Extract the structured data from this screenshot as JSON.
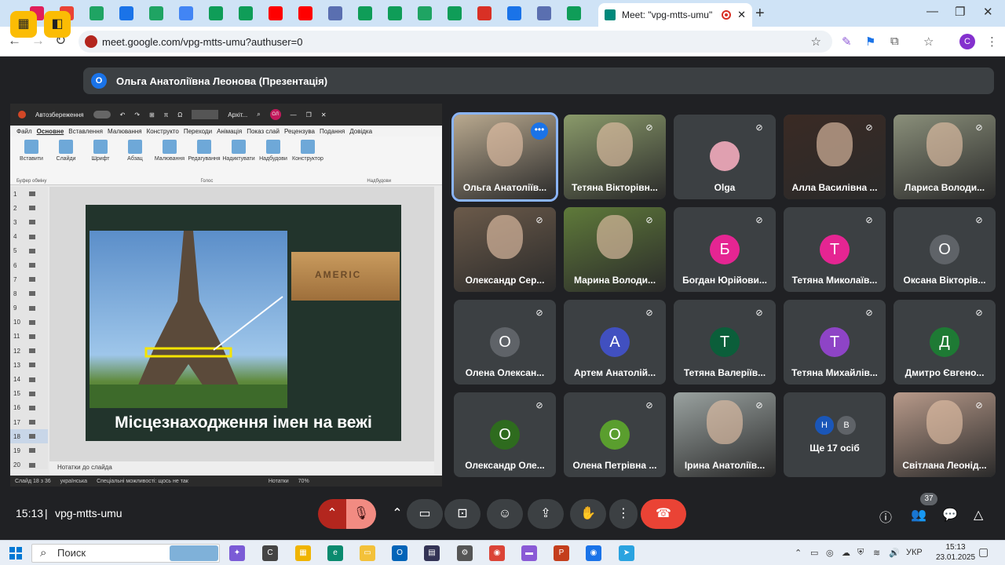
{
  "browser": {
    "active_tab_title": "Meet: \"vpg-mtts-umu\"",
    "url": "meet.google.com/vpg-mtts-umu?authuser=0",
    "profile_initial": "C",
    "tab_icons": [
      "slack-icon",
      "gmail-icon",
      "drive-icon",
      "contacts-icon",
      "drive-icon",
      "docs-icon",
      "sheets-icon",
      "sheets-icon",
      "youtube-icon",
      "youtube-icon",
      "site-icon",
      "sheets-icon",
      "sheets-icon",
      "drive-icon",
      "sheets-icon",
      "heart-icon",
      "notion-icon",
      "site-icon",
      "sheets-icon"
    ]
  },
  "presenter": {
    "initial": "О",
    "label": "Ольга Анатоліївна Леонова (Презентація)"
  },
  "presentation": {
    "autosave": "Автозбереження",
    "search_hint": "Архіт...",
    "user_initials": "ОЛ",
    "menu": [
      "Файл",
      "Основне",
      "Вставлення",
      "Малювання",
      "Конструкто",
      "Переходи",
      "Анімація",
      "Показ слай",
      "Рецензува",
      "Подання",
      "Довідка"
    ],
    "ribbon": [
      "Вставити",
      "Слайди",
      "Шрифт",
      "Абзац",
      "Малювання",
      "Редагування",
      "Надиктувати",
      "Надбудови",
      "Конструктор"
    ],
    "ribbon_groups": [
      "Буфер обміну",
      "Голос",
      "Надбудови"
    ],
    "thumb_numbers": [
      "1",
      "2",
      "3",
      "4",
      "5",
      "6",
      "7",
      "8",
      "9",
      "10",
      "11",
      "12",
      "13",
      "14",
      "15",
      "16",
      "17",
      "18",
      "19",
      "20"
    ],
    "slide_caption": "Місцезнаходження імен на вежі",
    "sign_text": "AMERIC",
    "notes": "Нотатки до слайда",
    "status": [
      "Слайд 18 з 36",
      "українська",
      "Спеціальні можливості: щось не так",
      "Нотатки",
      "70%"
    ]
  },
  "tiles": [
    {
      "name": "Ольга Анатоліїв...",
      "type": "video",
      "bg": "#b9a98f",
      "active": true,
      "muted": false
    },
    {
      "name": "Тетяна Вікторівн...",
      "type": "video",
      "bg": "#8a9a6a",
      "muted": true
    },
    {
      "name": "Olga",
      "type": "photo",
      "bg": "#3c4043",
      "avatar_color": "#e0a0b0",
      "muted": true
    },
    {
      "name": "Алла Василівна ...",
      "type": "video",
      "bg": "#3a2a24",
      "muted": true
    },
    {
      "name": "Лариса Володи...",
      "type": "video",
      "bg": "#8a8f7a",
      "muted": true
    },
    {
      "name": "Олександр Сер...",
      "type": "video",
      "bg": "#6b5a4a",
      "muted": true
    },
    {
      "name": "Марина Володи...",
      "type": "video",
      "bg": "#5f7a3a",
      "muted": true
    },
    {
      "name": "Богдан Юрійови...",
      "initial": "Б",
      "avatar_color": "#e52592",
      "muted": true
    },
    {
      "name": "Тетяна Миколаїв...",
      "initial": "Т",
      "avatar_color": "#e52592",
      "muted": true
    },
    {
      "name": "Оксана Вікторів...",
      "initial": "О",
      "avatar_color": "#5f6368",
      "muted": true
    },
    {
      "name": "Олена Олексан...",
      "initial": "О",
      "avatar_color": "#5f6368",
      "muted": true
    },
    {
      "name": "Артем Анатолій...",
      "initial": "А",
      "avatar_color": "#4150c0",
      "muted": true
    },
    {
      "name": "Тетяна Валеріїв...",
      "initial": "Т",
      "avatar_color": "#0b5e3a",
      "muted": true
    },
    {
      "name": "Тетяна Михайлів...",
      "initial": "Т",
      "avatar_color": "#8e44c6",
      "muted": true
    },
    {
      "name": "Дмитро Євгено...",
      "initial": "Д",
      "avatar_color": "#1e7a34",
      "muted": true
    },
    {
      "name": "Олександр Оле...",
      "initial": "О",
      "avatar_color": "#2e6b1e",
      "muted": true
    },
    {
      "name": "Олена Петрівна ...",
      "initial": "О",
      "avatar_color": "#5a9e2e",
      "muted": true
    },
    {
      "name": "Ірина Анатоліїв...",
      "type": "video",
      "bg": "#9aa2a0",
      "muted": true
    },
    {
      "name": "Ще 17 осіб",
      "type": "more",
      "minis": [
        "Н",
        "В"
      ]
    },
    {
      "name": "Світлана Леонід...",
      "type": "video",
      "bg": "#b89a8a",
      "muted": true
    }
  ],
  "bottom": {
    "time": "15:13",
    "separator": "|",
    "meeting_code": "vpg-mtts-umu",
    "people_count": "37"
  },
  "taskbar": {
    "search_placeholder": "Поиск",
    "lang": "УКР",
    "time": "15:13",
    "date": "23.01.2025"
  }
}
